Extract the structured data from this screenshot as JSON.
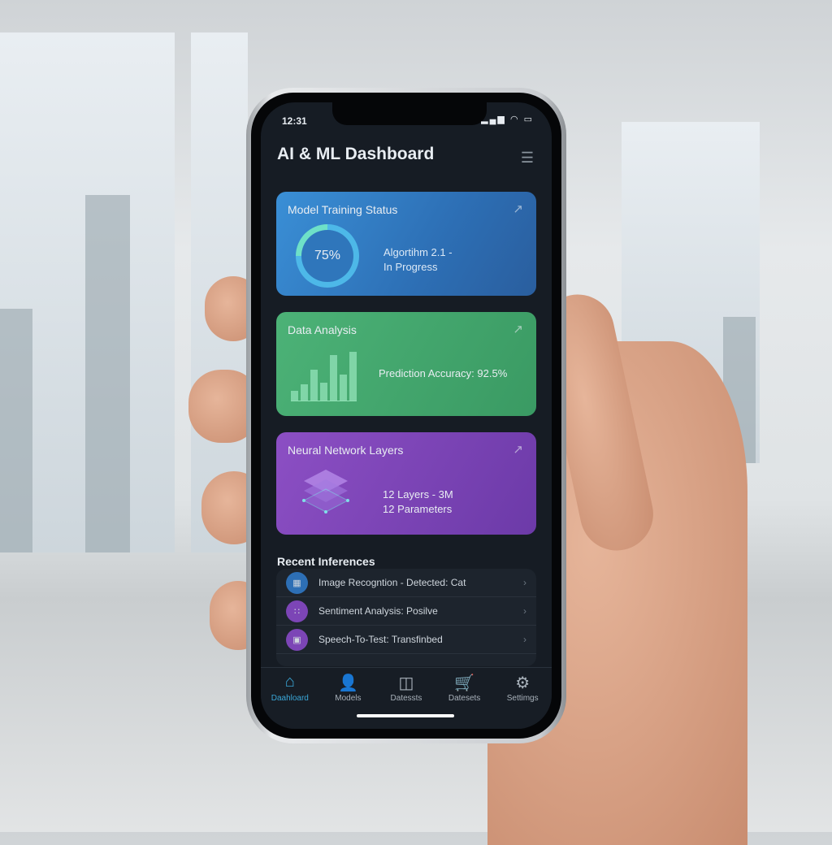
{
  "status_bar": {
    "time": "12:31",
    "indicators": "▂▄▆ ◠ ▭"
  },
  "header": {
    "title": "AI & ML Dashboard",
    "menu_icon": "☰"
  },
  "cards": {
    "training": {
      "title": "Model Training Status",
      "progress_label": "75%",
      "progress": 0.75,
      "line1": "Algortihm 2.1 -",
      "line2": "In Progress",
      "color": "#2f76bb"
    },
    "analysis": {
      "title": "Data Analysis",
      "accuracy": "Prediction Accuracy: 92.5%",
      "color": "#43a76d"
    },
    "network": {
      "title": "Neural Network Layers",
      "line1": "12 Layers - 3M",
      "line2": "12 Parameters",
      "color": "#7c45b6"
    }
  },
  "recent": {
    "title": "Recent Inferences",
    "items": [
      {
        "label": "Image Recogntion - Detected: Cat",
        "icon": "image-icon"
      },
      {
        "label": "Sentiment Analysis: Posilve",
        "icon": "sentiment-icon"
      },
      {
        "label": "Speech-To-Test: Transfinbed",
        "icon": "microphone-icon"
      }
    ]
  },
  "nav": {
    "items": [
      {
        "label": "Daahloard",
        "icon": "⌂"
      },
      {
        "label": "Models",
        "icon": "👤"
      },
      {
        "label": "Datessts",
        "icon": "◫"
      },
      {
        "label": "Datesets",
        "icon": "🛒"
      },
      {
        "label": "Settimgs",
        "icon": "⚙"
      }
    ]
  }
}
